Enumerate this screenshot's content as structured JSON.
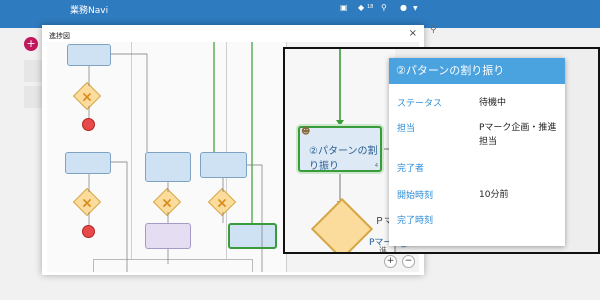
{
  "app": {
    "title": "業務Navi",
    "notification_count": "18",
    "fab_plus": "+",
    "fab_arrow": "»"
  },
  "dialog": {
    "title": "進捗図",
    "close": "×",
    "zoom_in": "+",
    "zoom_out": "−"
  },
  "zoom": {
    "task_label": "②パターンの割り振り",
    "task_number": "4",
    "bg_text_1": "Ｐマ",
    "bg_text_2": "Pマーク_[201",
    "bg_text_3": "進"
  },
  "popup": {
    "title": "②パターンの割り振り",
    "rows": [
      {
        "label": "ステータス",
        "value": "待機中"
      },
      {
        "label": "担当",
        "value": "Pマーク企画・推進担当"
      },
      {
        "label": "完了者",
        "value": ""
      },
      {
        "label": "開始時刻",
        "value": "10分前"
      },
      {
        "label": "完了時刻",
        "value": ""
      }
    ]
  },
  "colors": {
    "accent": "#2e7bbf",
    "popup_header": "#4aa3df",
    "active_task_border": "#3a9b3a",
    "gateway": "#fbdc9c",
    "end_event": "#e84a4a"
  }
}
